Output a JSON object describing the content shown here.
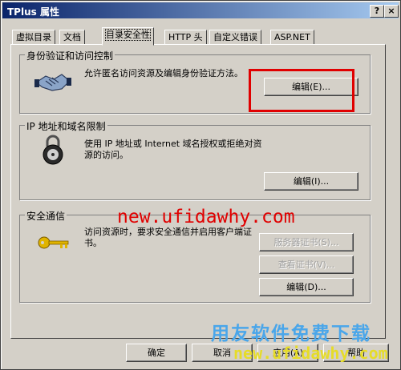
{
  "window": {
    "title": "TPlus 属性",
    "help": "?",
    "close": "×"
  },
  "tabs": [
    "虚拟目录",
    "文档",
    "目录安全性",
    "HTTP 头",
    "自定义错误",
    "ASP.NET"
  ],
  "auth": {
    "title": "身份验证和访问控制",
    "desc": "允许匿名访问资源及编辑身份验证方法。",
    "edit_button": "编辑(E)..."
  },
  "ip": {
    "title": "IP 地址和域名限制",
    "desc": "使用 IP 地址或 Internet 域名授权或拒绝对资源的访问。",
    "edit_button": "编辑(I)..."
  },
  "secure": {
    "title": "安全通信",
    "desc": "访问资源时，要求安全通信并启用客户端证书。",
    "server_cert_button": "服务器证书(S)...",
    "view_cert_button": "查看证书(V)...",
    "edit_button": "编辑(D)..."
  },
  "watermarks": {
    "site": "new.ufidawhy.com",
    "cn": "用友软件免费下载",
    "site2": "new.ufidawhy.com"
  },
  "footer": {
    "ok": "确定",
    "cancel": "取消",
    "apply": "应用(A)",
    "help": "帮助"
  },
  "colors": {
    "highlight_box": "#e00000",
    "title_bar": "#0a246a"
  }
}
